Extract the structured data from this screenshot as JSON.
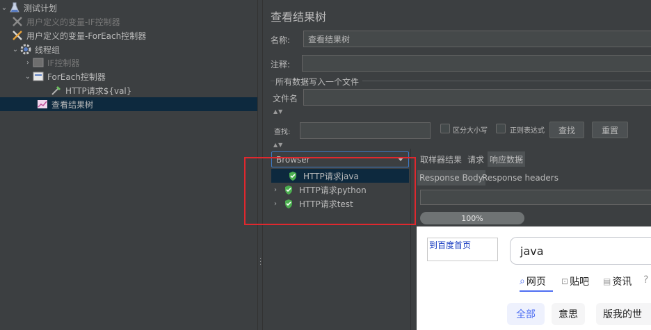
{
  "tree": {
    "root": "测试计划",
    "items": [
      {
        "label": "用户定义的变量-IF控制器",
        "disabled": true
      },
      {
        "label": "用户定义的变量-ForEach控制器",
        "disabled": false
      },
      {
        "label": "线程组",
        "disabled": false
      },
      {
        "label": "IF控制器",
        "disabled": true
      },
      {
        "label": "ForEach控制器",
        "disabled": false
      },
      {
        "label": "HTTP请求${val}",
        "disabled": false
      },
      {
        "label": "查看结果树",
        "disabled": false,
        "selected": true
      }
    ]
  },
  "panel": {
    "title": "查看结果树",
    "name_label": "名称:",
    "name_value": "查看结果树",
    "comment_label": "注释:",
    "comment_value": "",
    "group_title": "所有数据写入一个文件",
    "file_label": "文件名",
    "file_value": "",
    "search_label": "查找:",
    "search_value": "",
    "case_label": "区分大小写",
    "regex_label": "正则表达式",
    "find_button": "查找",
    "reset_button": "重置",
    "collapse_glyph": "▲▼"
  },
  "results": {
    "renderer": "Browser",
    "items": [
      {
        "label": "HTTP请求java",
        "selected": true
      },
      {
        "label": "HTTP请求python",
        "selected": false
      },
      {
        "label": "HTTP请求test",
        "selected": false
      }
    ],
    "tabs": [
      "取样器结果",
      "请求",
      "响应数据"
    ],
    "active_tab": "响应数据",
    "subtabs": [
      "Response Body",
      "Response headers"
    ],
    "active_subtab": "Response Body",
    "progress_text": "100%",
    "progress_value": 1.0
  },
  "page": {
    "home_link": "到百度首页",
    "search_query": "java",
    "nav": [
      "网页",
      "贴吧",
      "资讯"
    ],
    "chips": [
      "全部",
      "意思",
      "版我的世"
    ]
  },
  "colors": {
    "accent_blue": "#3d7bc8",
    "annotation_red": "#e0282e",
    "selection": "#0d293e",
    "success_green": "#4caf50"
  }
}
